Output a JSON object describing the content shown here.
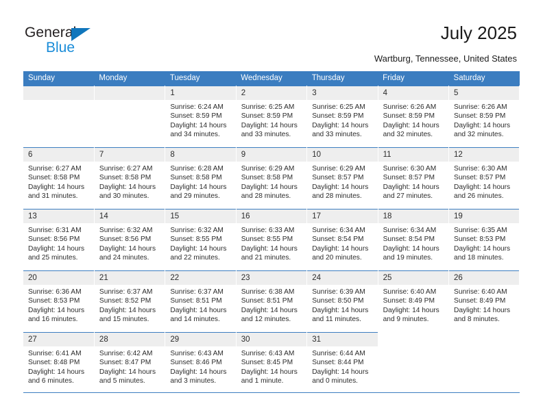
{
  "brand": {
    "name_part1": "General",
    "name_part2": "Blue",
    "triangle_color": "#1076bc",
    "blue_text_color": "#1a8cd8"
  },
  "header": {
    "title": "July 2025",
    "subtitle": "Wartburg, Tennessee, United States"
  },
  "theme": {
    "header_blue": "#3b7dc0",
    "daynum_gray": "#eeeeee",
    "text_color": "#2b2b2b"
  },
  "calendar": {
    "weekdays": [
      "Sunday",
      "Monday",
      "Tuesday",
      "Wednesday",
      "Thursday",
      "Friday",
      "Saturday"
    ],
    "labels": {
      "sunrise": "Sunrise:",
      "sunset": "Sunset:",
      "daylight": "Daylight:"
    },
    "weeks": [
      [
        {
          "day": "",
          "empty": true
        },
        {
          "day": "",
          "empty": true
        },
        {
          "day": "1",
          "sunrise": "Sunrise: 6:24 AM",
          "sunset": "Sunset: 8:59 PM",
          "daylight_line1": "Daylight: 14 hours",
          "daylight_line2": "and 34 minutes."
        },
        {
          "day": "2",
          "sunrise": "Sunrise: 6:25 AM",
          "sunset": "Sunset: 8:59 PM",
          "daylight_line1": "Daylight: 14 hours",
          "daylight_line2": "and 33 minutes."
        },
        {
          "day": "3",
          "sunrise": "Sunrise: 6:25 AM",
          "sunset": "Sunset: 8:59 PM",
          "daylight_line1": "Daylight: 14 hours",
          "daylight_line2": "and 33 minutes."
        },
        {
          "day": "4",
          "sunrise": "Sunrise: 6:26 AM",
          "sunset": "Sunset: 8:59 PM",
          "daylight_line1": "Daylight: 14 hours",
          "daylight_line2": "and 32 minutes."
        },
        {
          "day": "5",
          "sunrise": "Sunrise: 6:26 AM",
          "sunset": "Sunset: 8:59 PM",
          "daylight_line1": "Daylight: 14 hours",
          "daylight_line2": "and 32 minutes."
        }
      ],
      [
        {
          "day": "6",
          "sunrise": "Sunrise: 6:27 AM",
          "sunset": "Sunset: 8:58 PM",
          "daylight_line1": "Daylight: 14 hours",
          "daylight_line2": "and 31 minutes."
        },
        {
          "day": "7",
          "sunrise": "Sunrise: 6:27 AM",
          "sunset": "Sunset: 8:58 PM",
          "daylight_line1": "Daylight: 14 hours",
          "daylight_line2": "and 30 minutes."
        },
        {
          "day": "8",
          "sunrise": "Sunrise: 6:28 AM",
          "sunset": "Sunset: 8:58 PM",
          "daylight_line1": "Daylight: 14 hours",
          "daylight_line2": "and 29 minutes."
        },
        {
          "day": "9",
          "sunrise": "Sunrise: 6:29 AM",
          "sunset": "Sunset: 8:58 PM",
          "daylight_line1": "Daylight: 14 hours",
          "daylight_line2": "and 28 minutes."
        },
        {
          "day": "10",
          "sunrise": "Sunrise: 6:29 AM",
          "sunset": "Sunset: 8:57 PM",
          "daylight_line1": "Daylight: 14 hours",
          "daylight_line2": "and 28 minutes."
        },
        {
          "day": "11",
          "sunrise": "Sunrise: 6:30 AM",
          "sunset": "Sunset: 8:57 PM",
          "daylight_line1": "Daylight: 14 hours",
          "daylight_line2": "and 27 minutes."
        },
        {
          "day": "12",
          "sunrise": "Sunrise: 6:30 AM",
          "sunset": "Sunset: 8:57 PM",
          "daylight_line1": "Daylight: 14 hours",
          "daylight_line2": "and 26 minutes."
        }
      ],
      [
        {
          "day": "13",
          "sunrise": "Sunrise: 6:31 AM",
          "sunset": "Sunset: 8:56 PM",
          "daylight_line1": "Daylight: 14 hours",
          "daylight_line2": "and 25 minutes."
        },
        {
          "day": "14",
          "sunrise": "Sunrise: 6:32 AM",
          "sunset": "Sunset: 8:56 PM",
          "daylight_line1": "Daylight: 14 hours",
          "daylight_line2": "and 24 minutes."
        },
        {
          "day": "15",
          "sunrise": "Sunrise: 6:32 AM",
          "sunset": "Sunset: 8:55 PM",
          "daylight_line1": "Daylight: 14 hours",
          "daylight_line2": "and 22 minutes."
        },
        {
          "day": "16",
          "sunrise": "Sunrise: 6:33 AM",
          "sunset": "Sunset: 8:55 PM",
          "daylight_line1": "Daylight: 14 hours",
          "daylight_line2": "and 21 minutes."
        },
        {
          "day": "17",
          "sunrise": "Sunrise: 6:34 AM",
          "sunset": "Sunset: 8:54 PM",
          "daylight_line1": "Daylight: 14 hours",
          "daylight_line2": "and 20 minutes."
        },
        {
          "day": "18",
          "sunrise": "Sunrise: 6:34 AM",
          "sunset": "Sunset: 8:54 PM",
          "daylight_line1": "Daylight: 14 hours",
          "daylight_line2": "and 19 minutes."
        },
        {
          "day": "19",
          "sunrise": "Sunrise: 6:35 AM",
          "sunset": "Sunset: 8:53 PM",
          "daylight_line1": "Daylight: 14 hours",
          "daylight_line2": "and 18 minutes."
        }
      ],
      [
        {
          "day": "20",
          "sunrise": "Sunrise: 6:36 AM",
          "sunset": "Sunset: 8:53 PM",
          "daylight_line1": "Daylight: 14 hours",
          "daylight_line2": "and 16 minutes."
        },
        {
          "day": "21",
          "sunrise": "Sunrise: 6:37 AM",
          "sunset": "Sunset: 8:52 PM",
          "daylight_line1": "Daylight: 14 hours",
          "daylight_line2": "and 15 minutes."
        },
        {
          "day": "22",
          "sunrise": "Sunrise: 6:37 AM",
          "sunset": "Sunset: 8:51 PM",
          "daylight_line1": "Daylight: 14 hours",
          "daylight_line2": "and 14 minutes."
        },
        {
          "day": "23",
          "sunrise": "Sunrise: 6:38 AM",
          "sunset": "Sunset: 8:51 PM",
          "daylight_line1": "Daylight: 14 hours",
          "daylight_line2": "and 12 minutes."
        },
        {
          "day": "24",
          "sunrise": "Sunrise: 6:39 AM",
          "sunset": "Sunset: 8:50 PM",
          "daylight_line1": "Daylight: 14 hours",
          "daylight_line2": "and 11 minutes."
        },
        {
          "day": "25",
          "sunrise": "Sunrise: 6:40 AM",
          "sunset": "Sunset: 8:49 PM",
          "daylight_line1": "Daylight: 14 hours",
          "daylight_line2": "and 9 minutes."
        },
        {
          "day": "26",
          "sunrise": "Sunrise: 6:40 AM",
          "sunset": "Sunset: 8:49 PM",
          "daylight_line1": "Daylight: 14 hours",
          "daylight_line2": "and 8 minutes."
        }
      ],
      [
        {
          "day": "27",
          "sunrise": "Sunrise: 6:41 AM",
          "sunset": "Sunset: 8:48 PM",
          "daylight_line1": "Daylight: 14 hours",
          "daylight_line2": "and 6 minutes."
        },
        {
          "day": "28",
          "sunrise": "Sunrise: 6:42 AM",
          "sunset": "Sunset: 8:47 PM",
          "daylight_line1": "Daylight: 14 hours",
          "daylight_line2": "and 5 minutes."
        },
        {
          "day": "29",
          "sunrise": "Sunrise: 6:43 AM",
          "sunset": "Sunset: 8:46 PM",
          "daylight_line1": "Daylight: 14 hours",
          "daylight_line2": "and 3 minutes."
        },
        {
          "day": "30",
          "sunrise": "Sunrise: 6:43 AM",
          "sunset": "Sunset: 8:45 PM",
          "daylight_line1": "Daylight: 14 hours",
          "daylight_line2": "and 1 minute."
        },
        {
          "day": "31",
          "sunrise": "Sunrise: 6:44 AM",
          "sunset": "Sunset: 8:44 PM",
          "daylight_line1": "Daylight: 14 hours",
          "daylight_line2": "and 0 minutes."
        },
        {
          "day": "",
          "empty": true,
          "blank_cell": true
        },
        {
          "day": "",
          "empty": true,
          "blank_cell": true
        }
      ]
    ]
  }
}
